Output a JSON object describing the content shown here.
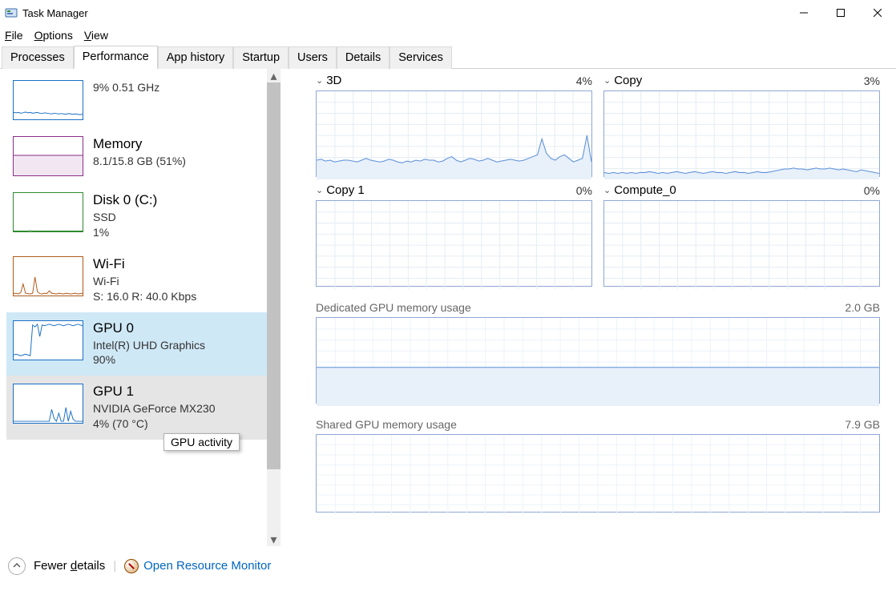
{
  "window": {
    "title": "Task Manager"
  },
  "menus": {
    "file": "File",
    "options": "Options",
    "view": "View"
  },
  "tabs": [
    "Processes",
    "Performance",
    "App history",
    "Startup",
    "Users",
    "Details",
    "Services"
  ],
  "active_tab": 1,
  "tooltip": "GPU activity",
  "sidebar": [
    {
      "title": "",
      "line1": "9%  0.51 GHz",
      "color": "#1a6fc4"
    },
    {
      "title": "Memory",
      "line1": "8.1/15.8 GB (51%)",
      "color": "#8a2d8a"
    },
    {
      "title": "Disk 0 (C:)",
      "line1": "SSD",
      "line2": "1%",
      "color": "#2e8a2e"
    },
    {
      "title": "Wi-Fi",
      "line1": "Wi-Fi",
      "line2": "S: 16.0  R: 40.0 Kbps",
      "color": "#b05a1a"
    },
    {
      "title": "GPU 0",
      "line1": "Intel(R) UHD Graphics",
      "line2": "90%",
      "color": "#1a6fc4"
    },
    {
      "title": "GPU 1",
      "line1": "NVIDIA GeForce MX230",
      "line2": "4%  (70 °C)",
      "color": "#1a6fc4"
    }
  ],
  "engines": [
    {
      "name": "3D",
      "pct": "4%"
    },
    {
      "name": "Copy",
      "pct": "3%"
    },
    {
      "name": "Copy 1",
      "pct": "0%"
    },
    {
      "name": "Compute_0",
      "pct": "0%"
    }
  ],
  "memory_sections": [
    {
      "label": "Dedicated GPU memory usage",
      "right": "2.0 GB"
    },
    {
      "label": "Shared GPU memory usage",
      "right": "7.9 GB"
    }
  ],
  "footer": {
    "fewer": "Fewer details",
    "open_rm": "Open Resource Monitor"
  },
  "chart_data": {
    "type": "line",
    "title": "GPU 0 engine utilization and memory",
    "series": [
      {
        "name": "3D",
        "ymax": 100,
        "values": [
          22,
          23,
          21,
          22,
          20,
          21,
          22,
          22,
          21,
          20,
          22,
          24,
          22,
          21,
          20,
          21,
          23,
          22,
          20,
          19,
          21,
          20,
          22,
          21,
          23,
          22,
          22,
          20,
          21,
          24,
          26,
          22,
          20,
          22,
          24,
          23,
          21,
          22,
          24,
          22,
          20,
          21,
          22,
          23,
          22,
          21,
          22,
          24,
          26,
          28,
          46,
          30,
          24,
          22,
          26,
          28,
          24,
          20,
          22,
          24,
          50,
          20
        ]
      },
      {
        "name": "Copy",
        "ymax": 100,
        "values": [
          8,
          7,
          8,
          7,
          8,
          7,
          8,
          7,
          8,
          8,
          9,
          8,
          7,
          8,
          7,
          8,
          9,
          8,
          7,
          8,
          9,
          8,
          7,
          8,
          9,
          8,
          8,
          7,
          8,
          9,
          8,
          8,
          7,
          8,
          9,
          8,
          8,
          9,
          10,
          11,
          12,
          12,
          13,
          12,
          12,
          11,
          12,
          13,
          12,
          12,
          13,
          12,
          11,
          12,
          11,
          10,
          9,
          11,
          10,
          9,
          8,
          7
        ]
      },
      {
        "name": "Copy 1",
        "ymax": 100,
        "values": [
          0,
          0,
          0,
          0,
          0,
          0,
          0,
          0,
          0,
          0,
          0,
          0,
          0,
          0,
          0,
          0,
          0,
          0,
          0,
          0,
          0,
          0,
          0,
          0,
          0,
          0,
          0,
          0,
          0,
          0,
          0,
          0,
          0,
          0,
          0,
          0,
          0,
          0,
          0,
          0,
          0,
          0,
          0,
          0,
          0,
          0,
          0,
          0,
          0,
          0,
          0,
          0,
          0,
          0,
          0,
          0,
          0,
          0,
          0,
          0,
          0,
          0
        ]
      },
      {
        "name": "Compute_0",
        "ymax": 100,
        "values": [
          0,
          0,
          0,
          0,
          0,
          0,
          0,
          0,
          0,
          0,
          0,
          0,
          0,
          0,
          0,
          0,
          0,
          0,
          0,
          0,
          0,
          0,
          0,
          0,
          0,
          0,
          0,
          0,
          0,
          0,
          0,
          0,
          0,
          0,
          0,
          0,
          0,
          0,
          0,
          0,
          0,
          0,
          0,
          0,
          0,
          0,
          0,
          0,
          0,
          0,
          0,
          0,
          0,
          0,
          0,
          0,
          0,
          0,
          0,
          0,
          0,
          0
        ]
      },
      {
        "name": "Dedicated GPU memory",
        "ymax": 2.0,
        "unit": "GB",
        "values": [
          0.88,
          0.88,
          0.88,
          0.88,
          0.88,
          0.88,
          0.88,
          0.88,
          0.88,
          0.88,
          0.88,
          0.88,
          0.88,
          0.88,
          0.88,
          0.88,
          0.88,
          0.88,
          0.88,
          0.88,
          0.88,
          0.88,
          0.88,
          0.88,
          0.88,
          0.88,
          0.88,
          0.88,
          0.88,
          0.88,
          0.88,
          0.88,
          0.88,
          0.88,
          0.88,
          0.88,
          0.88,
          0.88,
          0.88,
          0.88,
          0.88,
          0.88,
          0.88,
          0.88,
          0.88,
          0.88,
          0.88,
          0.88,
          0.88,
          0.88,
          0.88,
          0.88,
          0.88,
          0.88,
          0.88,
          0.88,
          0.88,
          0.88,
          0.88,
          0.88,
          0.88,
          0.88
        ]
      },
      {
        "name": "Shared GPU memory",
        "ymax": 7.9,
        "unit": "GB",
        "values": [
          0.05,
          0.05,
          0.05,
          0.05,
          0.05,
          0.05,
          0.05,
          0.05,
          0.05,
          0.05,
          0.05,
          0.05,
          0.05,
          0.05,
          0.05,
          0.05,
          0.05,
          0.05,
          0.05,
          0.05,
          0.05,
          0.05,
          0.05,
          0.05,
          0.05,
          0.05,
          0.05,
          0.05,
          0.05,
          0.05,
          0.05,
          0.05,
          0.05,
          0.05,
          0.05,
          0.05,
          0.05,
          0.05,
          0.05,
          0.05,
          0.05,
          0.05,
          0.05,
          0.05,
          0.05,
          0.05,
          0.05,
          0.05,
          0.05,
          0.05,
          0.05,
          0.05,
          0.05,
          0.05,
          0.05,
          0.05,
          0.05,
          0.05,
          0.05,
          0.05,
          0.05,
          0.05
        ]
      }
    ],
    "sidebar_thumbs": [
      {
        "name": "CPU",
        "values": [
          18,
          17,
          18,
          16,
          17,
          19,
          17,
          18,
          16,
          17,
          18,
          16,
          15,
          17,
          16,
          15,
          14,
          16,
          15,
          14,
          15,
          14,
          13,
          15,
          14,
          13,
          14,
          13,
          12,
          14
        ]
      },
      {
        "name": "Memory",
        "values": [
          51,
          51,
          51,
          51,
          51,
          51,
          51,
          51,
          51,
          51,
          51,
          51,
          51,
          51,
          51,
          51,
          51,
          51,
          51,
          51,
          51,
          51,
          51,
          51,
          51,
          51,
          51,
          51,
          51,
          51
        ]
      },
      {
        "name": "Disk",
        "values": [
          1,
          1,
          1,
          1,
          1,
          1,
          1,
          2,
          1,
          1,
          1,
          1,
          1,
          1,
          1,
          1,
          1,
          1,
          1,
          1,
          1,
          1,
          1,
          1,
          1,
          1,
          1,
          1,
          1,
          1
        ]
      },
      {
        "name": "Wi-Fi",
        "values": [
          5,
          6,
          4,
          8,
          30,
          6,
          5,
          4,
          6,
          48,
          10,
          5,
          4,
          6,
          5,
          12,
          6,
          5,
          4,
          6,
          5,
          4,
          6,
          5,
          4,
          5,
          6,
          4,
          5,
          6
        ]
      },
      {
        "name": "GPU 0",
        "values": [
          12,
          14,
          12,
          10,
          12,
          14,
          12,
          10,
          90,
          85,
          92,
          60,
          90,
          88,
          90,
          92,
          90,
          88,
          90,
          92,
          90,
          88,
          90,
          92,
          90,
          88,
          90,
          92,
          90,
          88
        ]
      },
      {
        "name": "GPU 1",
        "values": [
          4,
          4,
          4,
          4,
          4,
          4,
          4,
          4,
          4,
          4,
          4,
          4,
          4,
          4,
          4,
          4,
          35,
          12,
          4,
          25,
          4,
          4,
          40,
          4,
          30,
          10,
          4,
          4,
          4,
          4
        ]
      }
    ]
  }
}
